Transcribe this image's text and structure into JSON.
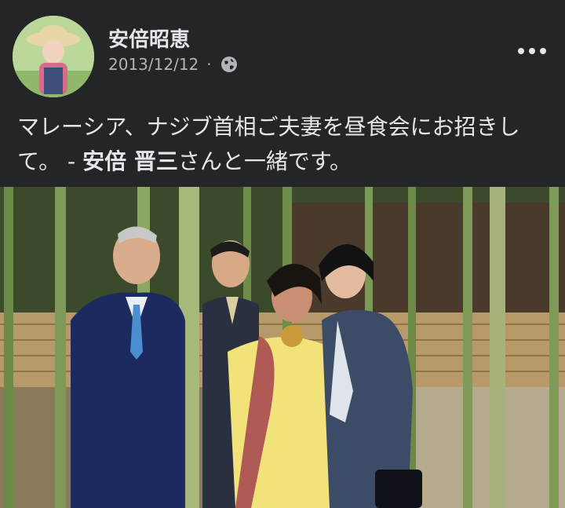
{
  "post": {
    "author": "安倍昭恵",
    "date": "2013/12/12",
    "separator": "·",
    "privacy_icon": "globe-icon",
    "more_icon": "more-horizontal-icon",
    "text_main": "マレーシア、ナジブ首相ご夫妻を昼食会にお招きして。 - ",
    "text_tag": "安倍 晋三",
    "text_end": "さんと一緒です。"
  },
  "colors": {
    "background": "#242526",
    "primary_text": "#e4e6eb",
    "secondary_text": "#b0b3b8"
  }
}
